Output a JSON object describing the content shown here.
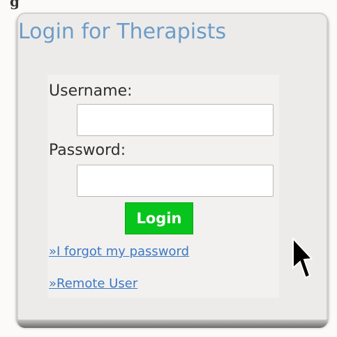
{
  "top_fragment": "g",
  "login_panel": {
    "title": "Login for Therapists",
    "username_label": "Username:",
    "username_value": "",
    "password_label": "Password:",
    "password_value": "",
    "login_button_label": "Login",
    "forgot_password_link": "»I forgot my password",
    "remote_user_link": "»Remote User"
  },
  "colors": {
    "title": "#6d9cc7",
    "login_button": "#07c51c",
    "link": "#3b78c4",
    "panel_background": "#ecebea"
  },
  "icons": {
    "cursor": "mouse-pointer-icon"
  }
}
